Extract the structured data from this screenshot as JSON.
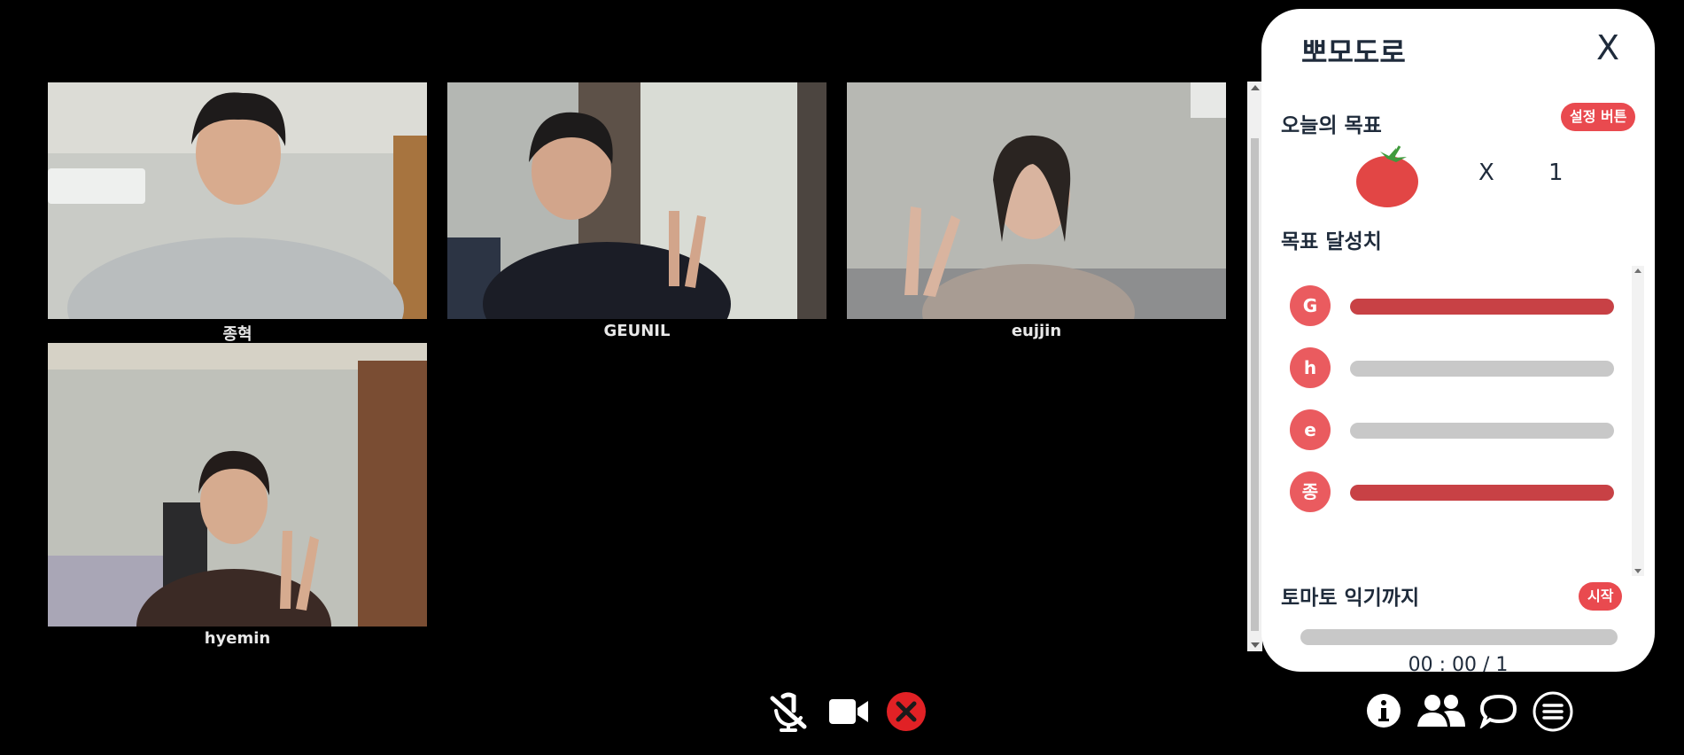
{
  "participants": [
    {
      "name": "종혁"
    },
    {
      "name": "GEUNIL"
    },
    {
      "name": "eujjin"
    },
    {
      "name": "hyemin"
    }
  ],
  "pomodoro": {
    "title": "뽀모도로",
    "close_label": "X",
    "goal_title": "오늘의 목표",
    "set_button": "설정 버튼",
    "goal_multiplier": "X",
    "goal_count": "1",
    "progress_title": "목표 달성치",
    "members": [
      {
        "initial": "G",
        "progress": 1.0
      },
      {
        "initial": "h",
        "progress": 0.0
      },
      {
        "initial": "e",
        "progress": 0.0
      },
      {
        "initial": "종",
        "progress": 1.0
      }
    ],
    "timer_title": "토마토 익기까지",
    "start_button": "시작",
    "timer_text": "00 : 00 / 1",
    "timer_progress": 0.0
  },
  "controls": {
    "mic_icon": "mic-off-icon",
    "camera_icon": "video-camera-icon",
    "leave_icon": "leave-call-icon",
    "info_icon": "info-icon",
    "people_icon": "participants-icon",
    "chat_icon": "chat-icon",
    "menu_icon": "menu-icon"
  },
  "colors": {
    "accent": "#e94a4f",
    "progress_fill": "#c84145",
    "panel_text": "#1f2b3b"
  }
}
